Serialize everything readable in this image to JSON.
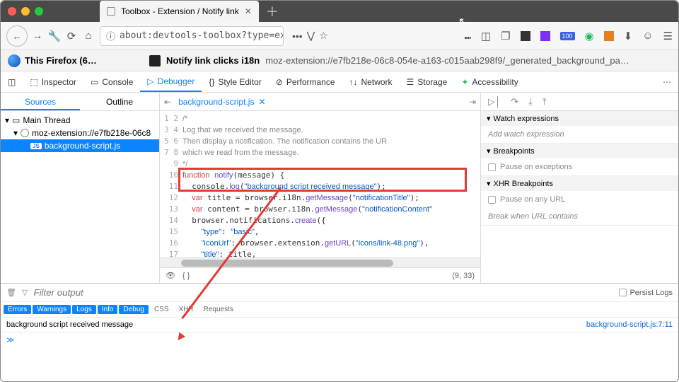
{
  "window": {
    "tab_title": "Toolbox - Extension / Notify link"
  },
  "url": "about:devtools-toolbox?type=exte",
  "ext_left": "This Firefox (6…",
  "ext_name": "Notify link clicks i18n",
  "ext_url": "moz-extension://e7fb218e-06c8-054e-a163-c015aab298f9/_generated_background_pa…",
  "devtabs": {
    "inspector": "Inspector",
    "console": "Console",
    "debugger": "Debugger",
    "style": "Style Editor",
    "perf": "Performance",
    "network": "Network",
    "storage": "Storage",
    "a11y": "Accessibility"
  },
  "sources_tab": "Sources",
  "outline_tab": "Outline",
  "tree": {
    "main": "Main Thread",
    "origin": "moz-extension://e7fb218e-06c8",
    "file": "background-script.js"
  },
  "file_tab": "background-script.js",
  "collapse_icon": "⇤",
  "gutter": [
    "1",
    "2",
    "3",
    "4",
    "5",
    "6",
    "7",
    "8",
    "9",
    "10",
    "11",
    "12",
    "13",
    "14",
    "15",
    "16",
    "17"
  ],
  "code_plain": {
    "l1": "/*",
    "l2": "Log that we received the message.",
    "l3": "Then display a notification. The notification contains the UR",
    "l4": "which we read from the message.",
    "l5": "*/"
  },
  "cursor_pos": "(9, 33)",
  "rp": {
    "watch": "Watch expressions",
    "watch_add": "Add watch expression",
    "bp": "Breakpoints",
    "bp_exc": "Pause on exceptions",
    "xhr": "XHR Breakpoints",
    "xhr_any": "Pause on any URL",
    "xhr_ph": "Break when URL contains"
  },
  "console": {
    "filter_ph": "Filter output",
    "persist": "Persist Logs",
    "filters": {
      "errors": "Errors",
      "warnings": "Warnings",
      "logs": "Logs",
      "info": "Info",
      "debug": "Debug",
      "css": "CSS",
      "xhr": "XHR",
      "requests": "Requests"
    },
    "msg": "background script received message",
    "src": "background-script.js:7:11",
    "prompt": "≫"
  }
}
